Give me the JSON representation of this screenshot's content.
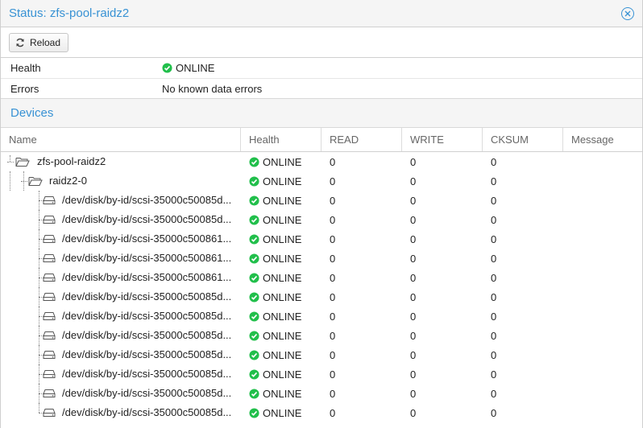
{
  "window": {
    "title": "Status: zfs-pool-raidz2"
  },
  "toolbar": {
    "reload_label": "Reload"
  },
  "summary": {
    "health_label": "Health",
    "health_value": "ONLINE",
    "errors_label": "Errors",
    "errors_value": "No known data errors"
  },
  "devices": {
    "section_title": "Devices",
    "columns": [
      "Name",
      "Health",
      "READ",
      "WRITE",
      "CKSUM",
      "Message"
    ],
    "rows": [
      {
        "name": "zfs-pool-raidz2",
        "level": 0,
        "icon": "folder-open-icon",
        "health": "ONLINE",
        "read": "0",
        "write": "0",
        "cksum": "0",
        "message": ""
      },
      {
        "name": "raidz2-0",
        "level": 1,
        "icon": "folder-open-icon",
        "health": "ONLINE",
        "read": "0",
        "write": "0",
        "cksum": "0",
        "message": ""
      },
      {
        "name": "/dev/disk/by-id/scsi-35000c50085d...",
        "level": 2,
        "icon": "hard-disk-icon",
        "health": "ONLINE",
        "read": "0",
        "write": "0",
        "cksum": "0",
        "message": ""
      },
      {
        "name": "/dev/disk/by-id/scsi-35000c50085d...",
        "level": 2,
        "icon": "hard-disk-icon",
        "health": "ONLINE",
        "read": "0",
        "write": "0",
        "cksum": "0",
        "message": ""
      },
      {
        "name": "/dev/disk/by-id/scsi-35000c500861...",
        "level": 2,
        "icon": "hard-disk-icon",
        "health": "ONLINE",
        "read": "0",
        "write": "0",
        "cksum": "0",
        "message": ""
      },
      {
        "name": "/dev/disk/by-id/scsi-35000c500861...",
        "level": 2,
        "icon": "hard-disk-icon",
        "health": "ONLINE",
        "read": "0",
        "write": "0",
        "cksum": "0",
        "message": ""
      },
      {
        "name": "/dev/disk/by-id/scsi-35000c500861...",
        "level": 2,
        "icon": "hard-disk-icon",
        "health": "ONLINE",
        "read": "0",
        "write": "0",
        "cksum": "0",
        "message": ""
      },
      {
        "name": "/dev/disk/by-id/scsi-35000c50085d...",
        "level": 2,
        "icon": "hard-disk-icon",
        "health": "ONLINE",
        "read": "0",
        "write": "0",
        "cksum": "0",
        "message": ""
      },
      {
        "name": "/dev/disk/by-id/scsi-35000c50085d...",
        "level": 2,
        "icon": "hard-disk-icon",
        "health": "ONLINE",
        "read": "0",
        "write": "0",
        "cksum": "0",
        "message": ""
      },
      {
        "name": "/dev/disk/by-id/scsi-35000c50085d...",
        "level": 2,
        "icon": "hard-disk-icon",
        "health": "ONLINE",
        "read": "0",
        "write": "0",
        "cksum": "0",
        "message": ""
      },
      {
        "name": "/dev/disk/by-id/scsi-35000c50085d...",
        "level": 2,
        "icon": "hard-disk-icon",
        "health": "ONLINE",
        "read": "0",
        "write": "0",
        "cksum": "0",
        "message": ""
      },
      {
        "name": "/dev/disk/by-id/scsi-35000c50085d...",
        "level": 2,
        "icon": "hard-disk-icon",
        "health": "ONLINE",
        "read": "0",
        "write": "0",
        "cksum": "0",
        "message": ""
      },
      {
        "name": "/dev/disk/by-id/scsi-35000c50085d...",
        "level": 2,
        "icon": "hard-disk-icon",
        "health": "ONLINE",
        "read": "0",
        "write": "0",
        "cksum": "0",
        "message": ""
      },
      {
        "name": "/dev/disk/by-id/scsi-35000c50085d...",
        "level": 2,
        "icon": "hard-disk-icon",
        "health": "ONLINE",
        "read": "0",
        "write": "0",
        "cksum": "0",
        "message": ""
      }
    ]
  },
  "colors": {
    "accent": "#3892d4",
    "ok": "#21bf4b"
  }
}
